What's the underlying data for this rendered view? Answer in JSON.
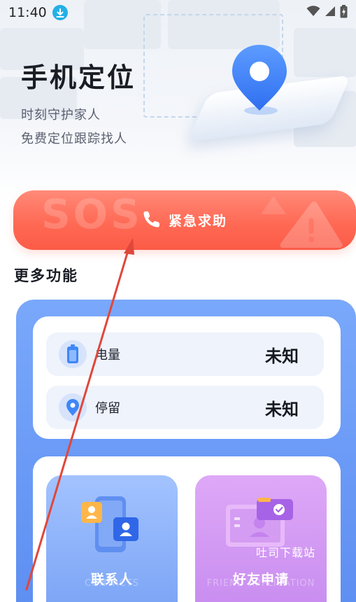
{
  "status_bar": {
    "time": "11:40",
    "download_icon": "download-icon",
    "wifi_icon": "wifi-icon",
    "signal_icon": "signal-icon",
    "battery_icon": "battery-charging-icon"
  },
  "hero": {
    "title": "手机定位",
    "subtitle_1": "时刻守护家人",
    "subtitle_2": "免费定位跟踪找人",
    "illustration_icon": "location-pin-icon"
  },
  "sos": {
    "watermark": "SOS",
    "label": "紧急求助",
    "icon": "phone-icon",
    "decor_icon": "warning-icon"
  },
  "more_features": {
    "title": "更多功能"
  },
  "info": {
    "battery": {
      "label": "电量",
      "value": "未知",
      "icon": "battery-icon"
    },
    "stay": {
      "label": "停留",
      "value": "未知",
      "icon": "location-pin-icon"
    }
  },
  "tiles": {
    "contacts": {
      "label": "联系人",
      "sub": "CONTACTS",
      "icon": "contacts-phone-icon"
    },
    "friend": {
      "label": "好友申请",
      "sub": "FRIEND APPLICATION",
      "icon": "friend-request-icon"
    }
  },
  "watermark": "吐司下载站",
  "colors": {
    "sos_red": "#ff6a55",
    "panel_blue": "#6b9bf6",
    "contacts_blue": "#8fb2fb",
    "friend_purple": "#d59ef4",
    "arrow_red": "#e0473a"
  }
}
